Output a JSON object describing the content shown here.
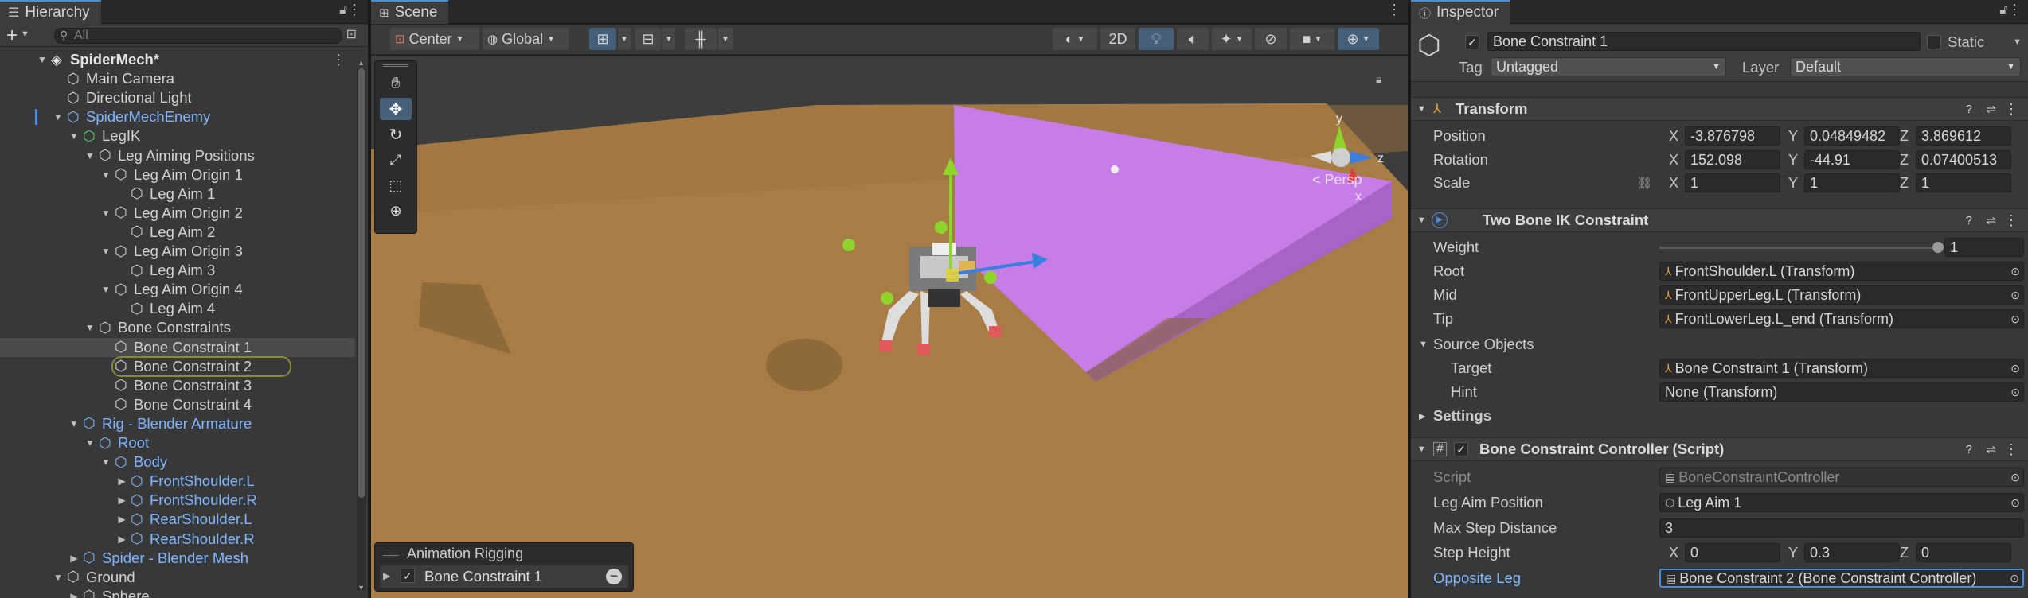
{
  "hierarchy": {
    "tab": "Hierarchy",
    "search_placeholder": "All",
    "add_label": "+",
    "items": [
      {
        "label": "SpiderMech*"
      },
      {
        "label": "Main Camera"
      },
      {
        "label": "Directional Light"
      },
      {
        "label": "SpiderMechEnemy"
      },
      {
        "label": "LegIK"
      },
      {
        "label": "Leg Aiming Positions"
      },
      {
        "label": "Leg Aim Origin 1"
      },
      {
        "label": "Leg Aim 1"
      },
      {
        "label": "Leg Aim Origin 2"
      },
      {
        "label": "Leg Aim 2"
      },
      {
        "label": "Leg Aim Origin 3"
      },
      {
        "label": "Leg Aim 3"
      },
      {
        "label": "Leg Aim Origin 4"
      },
      {
        "label": "Leg Aim 4"
      },
      {
        "label": "Bone Constraints"
      },
      {
        "label": "Bone Constraint 1"
      },
      {
        "label": "Bone Constraint 2"
      },
      {
        "label": "Bone Constraint 3"
      },
      {
        "label": "Bone Constraint 4"
      },
      {
        "label": "Rig - Blender Armature"
      },
      {
        "label": "Root"
      },
      {
        "label": "Body"
      },
      {
        "label": "FrontShoulder.L"
      },
      {
        "label": "FrontShoulder.R"
      },
      {
        "label": "RearShoulder.L"
      },
      {
        "label": "RearShoulder.R"
      },
      {
        "label": "Spider - Blender Mesh"
      },
      {
        "label": "Ground"
      },
      {
        "label": "Sphere"
      }
    ]
  },
  "scene": {
    "tab": "Scene",
    "pivot": "Center",
    "space": "Global",
    "mode_2d": "2D",
    "persp": "< Persp",
    "gizmo": {
      "y": "y",
      "z": "z",
      "x": "x"
    },
    "overlay": {
      "title": "Animation Rigging",
      "item": "Bone Constraint 1"
    }
  },
  "inspector": {
    "tab": "Inspector",
    "name": "Bone Constraint 1",
    "static": "Static",
    "tag_label": "Tag",
    "tag": "Untagged",
    "layer_label": "Layer",
    "layer": "Default",
    "transform": {
      "title": "Transform",
      "position": {
        "label": "Position",
        "x": "-3.876798",
        "y": "0.04849482",
        "z": "3.869612"
      },
      "rotation": {
        "label": "Rotation",
        "x": "152.098",
        "y": "-44.91",
        "z": "0.07400513"
      },
      "scale": {
        "label": "Scale",
        "x": "1",
        "y": "1",
        "z": "1"
      }
    },
    "ik": {
      "title": "Two Bone IK Constraint",
      "weight_label": "Weight",
      "weight": "1",
      "weight_fraction": 1,
      "root_label": "Root",
      "root": "FrontShoulder.L (Transform)",
      "mid_label": "Mid",
      "mid": "FrontUpperLeg.L (Transform)",
      "tip_label": "Tip",
      "tip": "FrontLowerLeg.L_end (Transform)",
      "source_label": "Source Objects",
      "target_label": "Target",
      "target": "Bone Constraint 1 (Transform)",
      "hint_label": "Hint",
      "hint": "None (Transform)",
      "settings_label": "Settings"
    },
    "script": {
      "title": "Bone Constraint Controller (Script)",
      "script_label": "Script",
      "script": "BoneConstraintController",
      "leg_aim_label": "Leg Aim Position",
      "leg_aim": "Leg Aim 1",
      "max_step_label": "Max Step Distance",
      "max_step": "3",
      "step_height_label": "Step Height",
      "sh_x": "0",
      "sh_y": "0.3",
      "sh_z": "0",
      "opp_label": "Opposite Leg",
      "opp": "Bone Constraint 2 (Bone Constraint Controller)"
    },
    "axes": {
      "x": "X",
      "y": "Y",
      "z": "Z"
    }
  },
  "colors": {
    "accent": "#4a8ee0",
    "ground": "#a87c45",
    "plane": "#c67de8",
    "link": "#7fb6ff"
  }
}
